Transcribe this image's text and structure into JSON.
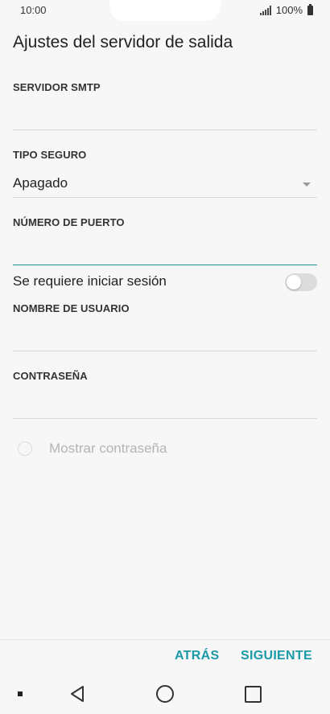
{
  "status": {
    "time": "10:00",
    "battery": "100%"
  },
  "title": "Ajustes del servidor de salida",
  "smtp": {
    "label": "SERVIDOR SMTP",
    "value": ""
  },
  "security": {
    "label": "TIPO SEGURO",
    "value": "Apagado"
  },
  "port": {
    "label": "NÚMERO DE PUERTO",
    "value": ""
  },
  "login": {
    "label": "Se requiere iniciar sesión",
    "enabled": false
  },
  "username": {
    "label": "NOMBRE DE USUARIO",
    "value": ""
  },
  "password": {
    "label": "CONTRASEÑA",
    "value": ""
  },
  "show_password": {
    "label": "Mostrar contraseña",
    "checked": false
  },
  "buttons": {
    "back": "ATRÁS",
    "next": "SIGUIENTE"
  }
}
